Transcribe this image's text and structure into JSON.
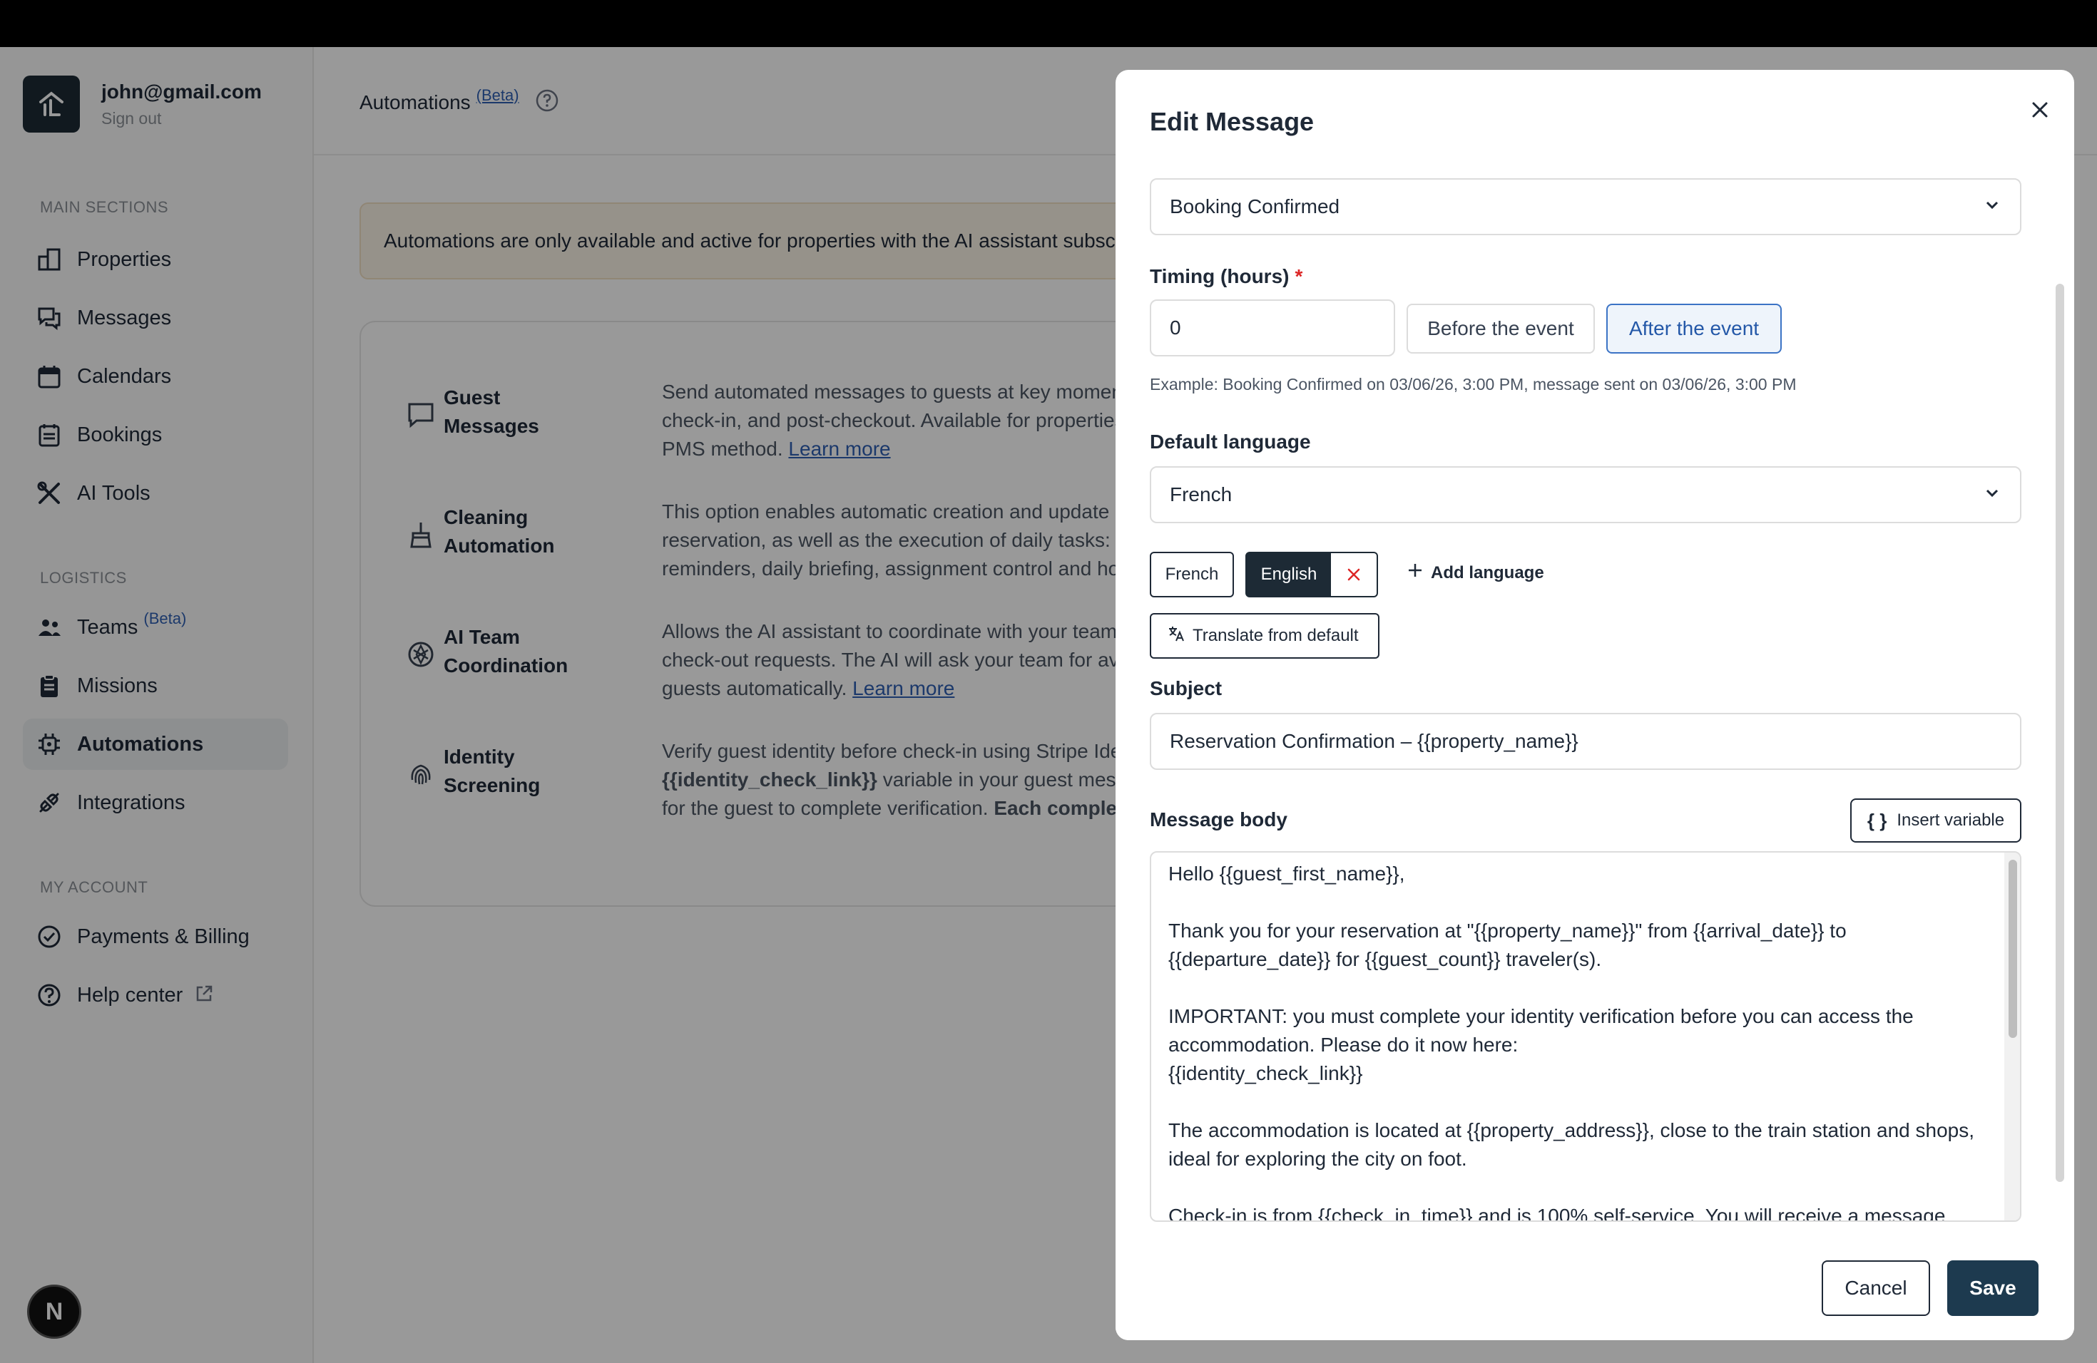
{
  "account": {
    "email": "john@gmail.com",
    "sign_out": "Sign out"
  },
  "sidebar": {
    "sections": [
      "MAIN SECTIONS",
      "LOGISTICS",
      "MY ACCOUNT"
    ],
    "main_items": [
      {
        "label": "Properties",
        "icon": "properties-icon"
      },
      {
        "label": "Messages",
        "icon": "messages-icon"
      },
      {
        "label": "Calendars",
        "icon": "calendar-icon"
      },
      {
        "label": "Bookings",
        "icon": "bookings-icon"
      },
      {
        "label": "AI Tools",
        "icon": "ai-tools-icon"
      }
    ],
    "logistics_items": [
      {
        "label": "Teams",
        "badge": "(Beta)",
        "icon": "teams-icon"
      },
      {
        "label": "Missions",
        "icon": "missions-icon"
      },
      {
        "label": "Automations",
        "icon": "automations-icon",
        "active": true
      },
      {
        "label": "Integrations",
        "icon": "integrations-icon"
      }
    ],
    "account_items": [
      {
        "label": "Payments & Billing",
        "icon": "billing-icon"
      },
      {
        "label": "Help center",
        "icon": "help-icon"
      }
    ],
    "fab_label": "N"
  },
  "main": {
    "title": "Automations",
    "beta": "(Beta)",
    "banner": "Automations are only available and active for properties with the AI assistant subsc",
    "features": [
      {
        "name": "Guest Messages",
        "desc_lines": [
          "Send automated messages to guests at key moments: b",
          "check-in, and post-checkout. Available for properties syn",
          "PMS method."
        ],
        "link": "Learn more"
      },
      {
        "name": "Cleaning Automation",
        "desc_lines": [
          "This option enables automatic creation and update of cl",
          "reservation, as well as the execution of daily tasks: miss",
          "reminders, daily briefing, assignment control and host al"
        ]
      },
      {
        "name": "AI Team Coordination",
        "desc_lines": [
          "Allows the AI assistant to coordinate with your team for",
          "check-out requests. The AI will ask your team for availab",
          "guests automatically."
        ],
        "link": "Learn more"
      },
      {
        "name": "Identity Screening",
        "desc_lines": [
          "Verify guest identity before check-in using Stripe Identity",
          "variable in your guest message te",
          "for the guest to complete verification."
        ],
        "bold_1": "{{identity_check_link}}",
        "bold_2": "Each completed ve"
      }
    ]
  },
  "modal": {
    "title": "Edit Message",
    "event_select": "Booking Confirmed",
    "timing_label": "Timing (hours)",
    "required_mark": "*",
    "timing_value": "0",
    "before_label": "Before the event",
    "after_label": "After the event",
    "example": "Example: Booking Confirmed on 03/06/26, 3:00 PM, message sent on 03/06/26, 3:00 PM",
    "default_language_label": "Default language",
    "default_language": "French",
    "chip_french": "French",
    "chip_english": "English",
    "add_language": "Add language",
    "translate_button": "Translate from default",
    "subject_label": "Subject",
    "subject_value": "Reservation Confirmation – {{property_name}}",
    "body_label": "Message body",
    "insert_variable": "Insert variable",
    "insert_variable_glyph": "{ }",
    "body_value": "Hello {{guest_first_name}},\n\nThank you for your reservation at \"{{property_name}}\" from {{arrival_date}} to\n{{departure_date}} for {{guest_count}} traveler(s).\n\nIMPORTANT: you must complete your identity verification before you can access the\naccommodation. Please do it now here:\n{{identity_check_link}}\n\nThe accommodation is located at {{property_address}}, close to the train station and shops,\nideal for exploring the city on foot.\n\nCheck-in is from {{check_in_time}} and is 100% self-service. You will receive a message",
    "cancel": "Cancel",
    "save": "Save"
  },
  "colors": {
    "primary": "#1d3a4f",
    "accent_blue": "#3b73c5",
    "danger": "#dc2626",
    "banner_bg": "#fbf3e7"
  }
}
